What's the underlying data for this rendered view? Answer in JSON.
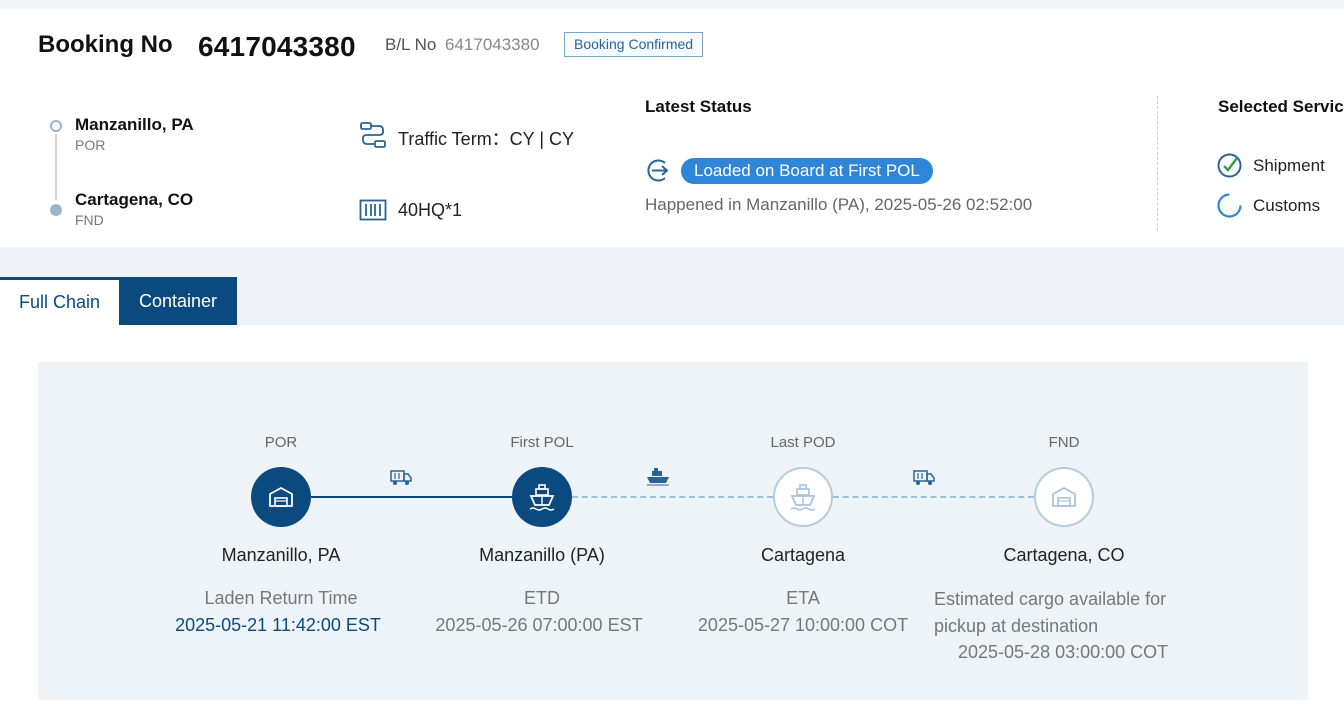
{
  "header": {
    "booking_label": "Booking No",
    "booking_no": "6417043380",
    "bl_label": "B/L No",
    "bl_no": "6417043380",
    "status_badge": "Booking Confirmed"
  },
  "route": {
    "origin": {
      "name": "Manzanillo, PA",
      "type": "POR"
    },
    "destination": {
      "name": "Cartagena, CO",
      "type": "FND"
    }
  },
  "traffic_term": "Traffic Term：CY | CY",
  "container_spec": "40HQ*1",
  "latest_status": {
    "title": "Latest Status",
    "status": "Loaded on Board at First POL",
    "happened": "Happened in Manzanillo (PA), 2025-05-26 02:52:00"
  },
  "selected_services": {
    "title": "Selected Servic",
    "items": [
      {
        "label": "Shipment",
        "icon": "check-circle-icon",
        "state": "done"
      },
      {
        "label": "Customs",
        "icon": "loading-circle-icon",
        "state": "pending"
      }
    ]
  },
  "tabs": [
    {
      "label": "Full Chain",
      "active": false
    },
    {
      "label": "Container",
      "active": true
    }
  ],
  "chain": {
    "nodes": [
      {
        "label": "POR",
        "name": "Manzanillo, PA",
        "sub": "Laden Return Time",
        "time": "2025-05-21 11:42:00 EST",
        "icon": "warehouse-icon",
        "reached": true
      },
      {
        "label": "First POL",
        "name": "Manzanillo (PA)",
        "sub": "ETD",
        "time": "2025-05-26 07:00:00 EST",
        "icon": "ship-icon",
        "reached": true
      },
      {
        "label": "Last POD",
        "name": "Cartagena",
        "sub": "ETA",
        "time": "2025-05-27 10:00:00 COT",
        "icon": "ship-icon",
        "reached": false
      },
      {
        "label": "FND",
        "name": "Cartagena, CO",
        "sub": "Estimated cargo available for pickup at destination",
        "time": "2025-05-28 03:00:00 COT",
        "icon": "warehouse-icon",
        "reached": false
      }
    ],
    "segments": [
      {
        "mode": "truck-icon",
        "done": true
      },
      {
        "mode": "vessel-icon",
        "done": false
      },
      {
        "mode": "truck-icon",
        "done": false
      }
    ]
  },
  "colors": {
    "primary": "#0b4a7f",
    "status_pill": "#2f86d8",
    "check_green": "#3a9a4a",
    "pending_blue": "#2f86d8"
  }
}
